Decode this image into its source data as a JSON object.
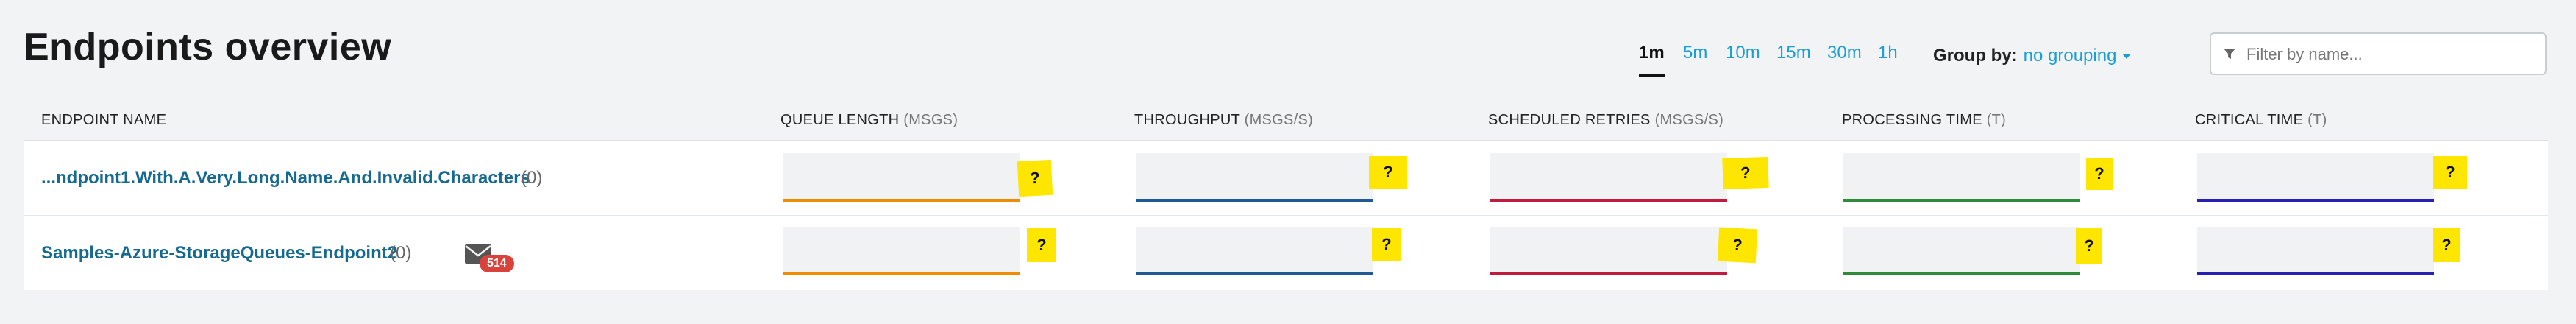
{
  "page": {
    "title": "Endpoints overview"
  },
  "periods": [
    "1m",
    "5m",
    "10m",
    "15m",
    "30m",
    "1h"
  ],
  "selected_period": "1m",
  "group_by": {
    "label": "Group by:",
    "value": "no grouping"
  },
  "filter": {
    "placeholder": "Filter by name...",
    "value": ""
  },
  "columns": {
    "endpoint_name": {
      "label": "ENDPOINT NAME",
      "unit": ""
    },
    "queue_length": {
      "label": "QUEUE LENGTH",
      "unit": "(MSGS)"
    },
    "throughput": {
      "label": "THROUGHPUT",
      "unit": "(MSGS/S)"
    },
    "scheduled_retries": {
      "label": "SCHEDULED RETRIES",
      "unit": "(MSGS/S)"
    },
    "processing_time": {
      "label": "PROCESSING TIME",
      "unit": "(T)"
    },
    "critical_time": {
      "label": "CRITICAL TIME",
      "unit": "(T)"
    }
  },
  "colors": {
    "queue_length": "#f08c00",
    "throughput": "#1f5a96",
    "scheduled_retries": "#c2193f",
    "processing_time": "#2e8b3a",
    "critical_time": "#2a1fb4",
    "accent": "#1a9ed4",
    "badge": "#d9433b"
  },
  "rows": [
    {
      "name": "...ndpoint1.With.A.Very.Long.Name.And.Invalid.Characters",
      "count": "(0)",
      "metrics": {
        "queue_length": "?",
        "throughput": "?",
        "scheduled_retries": "?",
        "processing_time": "?",
        "critical_time": "?"
      }
    },
    {
      "name": "Samples-Azure-StorageQueues-Endpoint2",
      "count": "(0)",
      "mail_icon": "envelope-icon",
      "badge": "514",
      "metrics": {
        "queue_length": "?",
        "throughput": "?",
        "scheduled_retries": "?",
        "processing_time": "?",
        "critical_time": "?"
      }
    }
  ]
}
